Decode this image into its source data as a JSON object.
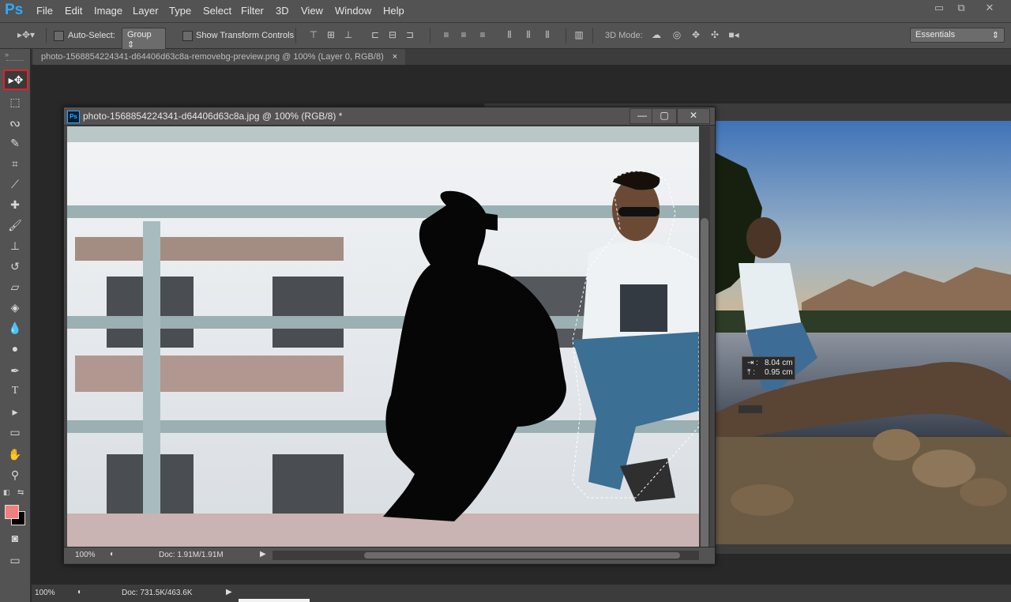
{
  "app": {
    "logo": "Ps"
  },
  "menu": {
    "items": [
      "File",
      "Edit",
      "Image",
      "Layer",
      "Type",
      "Select",
      "Filter",
      "3D",
      "View",
      "Window",
      "Help"
    ]
  },
  "window_controls": {
    "minimize": "▭",
    "restore": "⧉",
    "close": "✕"
  },
  "options_bar": {
    "auto_select_label": "Auto-Select:",
    "auto_select_target": "Group",
    "show_transform_label": "Show Transform Controls",
    "mode_3d_label": "3D Mode:",
    "workspace": "Essentials"
  },
  "tabs": {
    "active": "photo-1568854224341-d64406d63c8a-removebg-preview.png @ 100% (Layer 0, RGB/8)",
    "close": "×"
  },
  "document": {
    "title": "photo-1568854224341-d64406d63c8a.jpg @ 100% (RGB/8) *",
    "badge": "Ps",
    "zoom": "100%",
    "doc_size": "Doc: 1.91M/1.91M",
    "controls": {
      "minimize": "—",
      "maximize": "▢",
      "close": "✕"
    }
  },
  "measure": {
    "width": "8.04 cm",
    "height": "0.95 cm"
  },
  "bottom_status": {
    "zoom": "100%",
    "doc_size": "Doc: 731.5K/463.6K"
  },
  "colors": {
    "foreground": "#f08080",
    "background": "#000000",
    "highlight": "#e0212b"
  }
}
